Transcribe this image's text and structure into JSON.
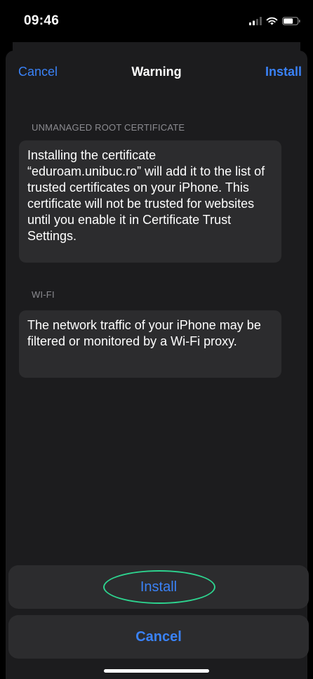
{
  "status_bar": {
    "time": "09:46",
    "icons": [
      "signal-icon",
      "wifi-icon",
      "battery-icon"
    ]
  },
  "nav": {
    "cancel_label": "Cancel",
    "title": "Warning",
    "install_label": "Install"
  },
  "sections": [
    {
      "header": "UNMANAGED ROOT CERTIFICATE",
      "body": "Installing the certificate “eduroam.unibuc.ro” will add it to the list of trusted certificates on your iPhone. This certificate will not be trusted for websites until you enable it in Certificate Trust Settings."
    },
    {
      "header": "WI-FI",
      "body": "The network traffic of your iPhone may be filtered or monitored by a Wi-Fi proxy."
    }
  ],
  "action_sheet": {
    "install_label": "Install",
    "cancel_label": "Cancel"
  },
  "colors": {
    "accent": "#3a82f7",
    "highlight": "#2dd48f",
    "card": "#2c2c2e",
    "sheet": "#1c1c1e"
  }
}
